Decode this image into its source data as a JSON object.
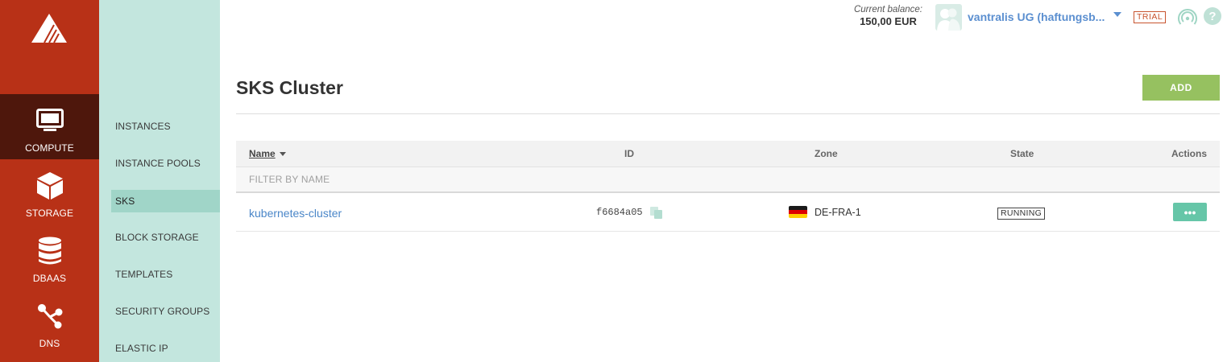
{
  "rail": {
    "items": [
      {
        "label": "COMPUTE",
        "icon": "monitor-icon",
        "active": true
      },
      {
        "label": "STORAGE",
        "icon": "cube-icon"
      },
      {
        "label": "DBAAS",
        "icon": "database-icon"
      },
      {
        "label": "DNS",
        "icon": "share-nodes-icon"
      }
    ]
  },
  "subnav": {
    "items": [
      {
        "label": "INSTANCES"
      },
      {
        "label": "INSTANCE POOLS"
      },
      {
        "label": "SKS",
        "active": true
      },
      {
        "label": "BLOCK STORAGE"
      },
      {
        "label": "TEMPLATES"
      },
      {
        "label": "SECURITY GROUPS"
      },
      {
        "label": "ELASTIC IP"
      }
    ]
  },
  "topbar": {
    "balance_caption": "Current balance:",
    "balance_amount": "150,00 EUR",
    "org_name": "vantralis UG (haftungsb...",
    "trial_badge": "TRIAL",
    "help_label": "?"
  },
  "main": {
    "title": "SKS Cluster",
    "add_label": "ADD",
    "table": {
      "columns": {
        "name": "Name",
        "id": "ID",
        "zone": "Zone",
        "state": "State",
        "actions": "Actions"
      },
      "filter_placeholder": "FILTER BY NAME",
      "rows": [
        {
          "name": "kubernetes-cluster",
          "id": "f6684a05",
          "zone": "DE-FRA-1",
          "state": "RUNNING",
          "actions_label": "•••"
        }
      ]
    }
  },
  "colors": {
    "rail_bg": "#b83117",
    "rail_active": "#4e170c",
    "subnav_bg": "#c3e6de",
    "accent_green": "#96c160",
    "link_blue": "#4a86c8"
  }
}
